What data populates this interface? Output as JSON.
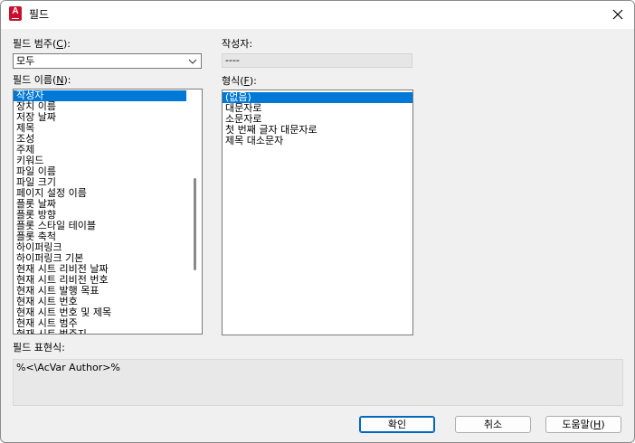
{
  "window": {
    "title": "필드",
    "app_icon_letter": "A"
  },
  "field_category": {
    "label_prefix": "필드 범주(",
    "label_key": "C",
    "label_suffix": "):",
    "value": "모두"
  },
  "author": {
    "label": "작성자:",
    "value": "----"
  },
  "field_names": {
    "label_prefix": "필드 이름(",
    "label_key": "N",
    "label_suffix": "):",
    "items": [
      "작성자",
      "장치 이름",
      "저장 날짜",
      "제목",
      "조성",
      "주제",
      "키워드",
      "파일 이름",
      "파일 크기",
      "페이지 설정 이름",
      "플롯 날짜",
      "플롯 방향",
      "플롯 스타일 테이블",
      "플롯 축척",
      "하이퍼링크",
      "하이퍼링크 기본",
      "현재 시트 리비전 날짜",
      "현재 시트 리비전 번호",
      "현재 시트 발행 목표",
      "현재 시트 번호",
      "현재 시트 번호 및 제목",
      "현재 시트 범주",
      "현재 시트 범주지"
    ]
  },
  "format": {
    "label_prefix": "형식(",
    "label_key": "F",
    "label_suffix": "):",
    "items": [
      "(없음)",
      "대문자로",
      "소문자로",
      "첫 번째 글자 대문자로",
      "제목 대소문자"
    ]
  },
  "field_expression": {
    "label": "필드 표현식:",
    "value": "%<\\AcVar Author>%"
  },
  "buttons": {
    "ok": "확인",
    "cancel": "취소",
    "help_prefix": "도움말(",
    "help_key": "H",
    "help_suffix": ")"
  }
}
